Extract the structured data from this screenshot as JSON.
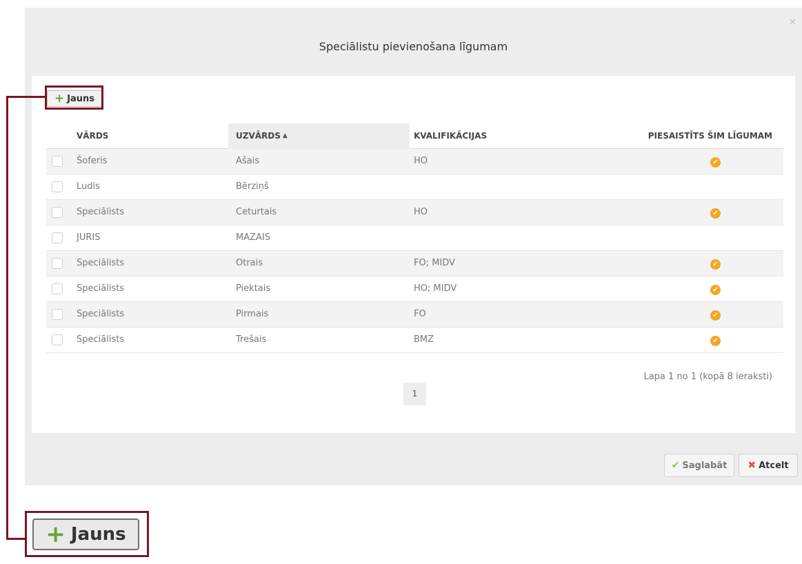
{
  "modal": {
    "title": "Speciālistu pievienošana līgumam",
    "close_glyph": "×"
  },
  "toolbar": {
    "new_icon": "plus-icon",
    "new_label": "Jauns"
  },
  "table": {
    "columns": {
      "name": "VĀRDS",
      "surname": "UZVĀRDS",
      "qualifications": "KVALIFIKĀCIJAS",
      "attached": "PIESAISTĪTS ŠIM LĪGUMAM"
    },
    "sort_icon": "caret-up-icon",
    "rows": [
      {
        "name": "Šoferis",
        "surname": "Ašais",
        "qualifications": "HO",
        "attached": true
      },
      {
        "name": "Ludis",
        "surname": "Bērziņš",
        "qualifications": "",
        "attached": false
      },
      {
        "name": "Speciālists",
        "surname": "Ceturtais",
        "qualifications": "HO",
        "attached": true
      },
      {
        "name": "JURIS",
        "surname": "MAZAIS",
        "qualifications": "",
        "attached": false
      },
      {
        "name": "Speciālists",
        "surname": "Otrais",
        "qualifications": "FO; MIDV",
        "attached": true
      },
      {
        "name": "Speciālists",
        "surname": "Piektais",
        "qualifications": "HO; MIDV",
        "attached": true
      },
      {
        "name": "Speciālists",
        "surname": "Pirmais",
        "qualifications": "FO",
        "attached": true
      },
      {
        "name": "Speciālists",
        "surname": "Trešais",
        "qualifications": "BMZ",
        "attached": true
      }
    ]
  },
  "pagination": {
    "info": "Lapa 1 no 1 (kopā 8 ieraksti)",
    "current_page": "1"
  },
  "footer": {
    "save_label": "Saglabāt",
    "cancel_label": "Atcelt"
  },
  "zoom": {
    "new_label": "Jauns"
  },
  "colors": {
    "highlight": "#7a1622",
    "attached_check": "#f5a623",
    "plus": "#6aa33a"
  }
}
